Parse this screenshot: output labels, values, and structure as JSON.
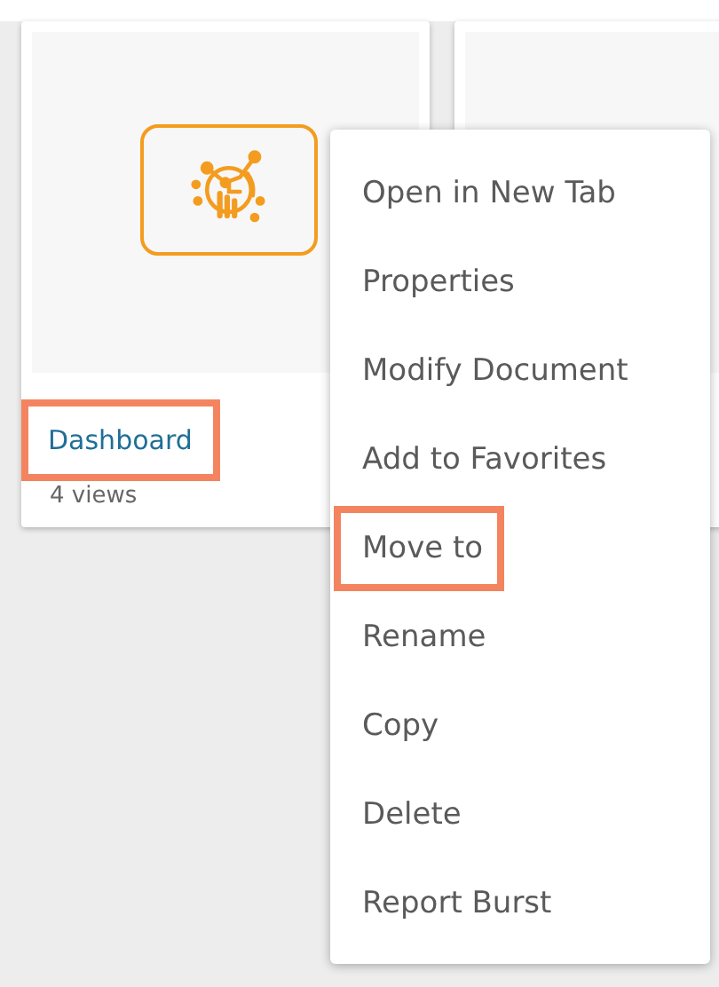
{
  "cards": [
    {
      "title": "Dashboard",
      "views": "4 views",
      "title_highlighted": true,
      "kind": "dashboard"
    },
    {
      "kind": "blank"
    }
  ],
  "context_menu": {
    "items": [
      {
        "label": "Open in New Tab",
        "highlighted": false
      },
      {
        "label": "Properties",
        "highlighted": false
      },
      {
        "label": "Modify Document",
        "highlighted": false
      },
      {
        "label": "Add to Favorites",
        "highlighted": false
      },
      {
        "label": "Move to",
        "highlighted": true
      },
      {
        "label": "Rename",
        "highlighted": false
      },
      {
        "label": "Copy",
        "highlighted": false
      },
      {
        "label": "Delete",
        "highlighted": false
      },
      {
        "label": "Report Burst",
        "highlighted": false
      }
    ]
  }
}
